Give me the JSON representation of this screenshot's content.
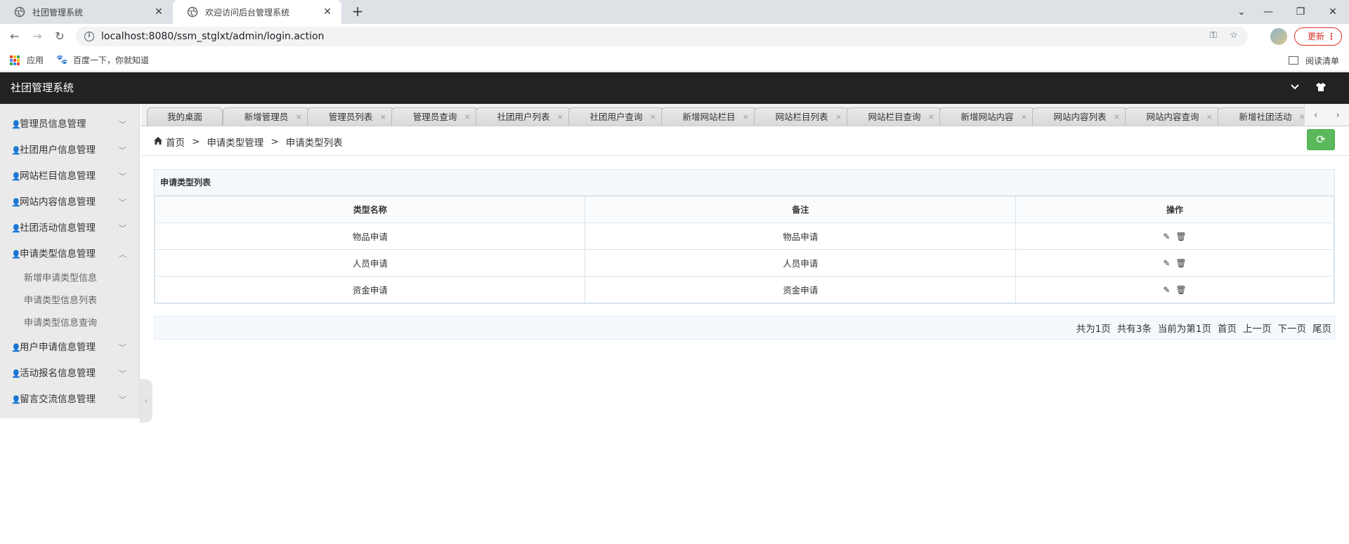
{
  "browser": {
    "tabs": [
      {
        "title": "社团管理系统",
        "close": "✕"
      },
      {
        "title": "欢迎访问后台管理系统",
        "close": "✕"
      }
    ],
    "new_tab": "+",
    "window_controls": {
      "download": "⌄",
      "minimize": "—",
      "restore": "❐",
      "close": "✕"
    },
    "url": "localhost:8080/ssm_stglxt/admin/login.action",
    "update_label": "更新",
    "bookmarks": {
      "apps": "应用",
      "baidu": "百度一下，你就知道",
      "reading_list": "阅读清单"
    }
  },
  "app": {
    "title": "社团管理系统"
  },
  "sidebar": {
    "items": [
      {
        "label": "管理员信息管理",
        "chevron": "﹀"
      },
      {
        "label": "社团用户信息管理",
        "chevron": "﹀"
      },
      {
        "label": "网站栏目信息管理",
        "chevron": "﹀"
      },
      {
        "label": "网站内容信息管理",
        "chevron": "﹀"
      },
      {
        "label": "社团活动信息管理",
        "chevron": "﹀"
      },
      {
        "label": "申请类型信息管理",
        "chevron": "︿"
      },
      {
        "label": "用户申请信息管理",
        "chevron": "﹀"
      },
      {
        "label": "活动报名信息管理",
        "chevron": "﹀"
      },
      {
        "label": "留言交流信息管理",
        "chevron": "﹀"
      }
    ],
    "subitems": [
      "新增申请类型信息",
      "申请类型信息列表",
      "申请类型信息查询"
    ],
    "collapse": "‹"
  },
  "content_tabs": [
    {
      "label": "我的桌面",
      "close": ""
    },
    {
      "label": "新增管理员",
      "close": "×"
    },
    {
      "label": "管理员列表",
      "close": "×"
    },
    {
      "label": "管理员查询",
      "close": "×"
    },
    {
      "label": "社团用户列表",
      "close": "×"
    },
    {
      "label": "社团用户查询",
      "close": "×"
    },
    {
      "label": "新增网站栏目",
      "close": "×"
    },
    {
      "label": "网站栏目列表",
      "close": "×"
    },
    {
      "label": "网站栏目查询",
      "close": "×"
    },
    {
      "label": "新增网站内容",
      "close": "×"
    },
    {
      "label": "网站内容列表",
      "close": "×"
    },
    {
      "label": "网站内容查询",
      "close": "×"
    },
    {
      "label": "新增社团活动",
      "close": "×"
    }
  ],
  "tab_scroll": {
    "prev": "‹",
    "next": "›"
  },
  "breadcrumb": {
    "home": "首页",
    "sep": ">",
    "level1": "申请类型管理",
    "level2": "申请类型列表"
  },
  "panel": {
    "title": "申请类型列表",
    "columns": [
      "类型名称",
      "备注",
      "操作"
    ],
    "rows": [
      {
        "name": "物品申请",
        "remark": "物品申请"
      },
      {
        "name": "人员申请",
        "remark": "人员申请"
      },
      {
        "name": "资金申请",
        "remark": "资金申请"
      }
    ]
  },
  "pager": {
    "total_pages": "共为1页",
    "total_records": "共有3条",
    "current": "当前为第1页",
    "first": "首页",
    "prev": "上一页",
    "next": "下一页",
    "last": "尾页"
  },
  "colors": {
    "header_bg": "#222222",
    "sidebar_bg": "#eaeaea",
    "refresh_green": "#5cb85c",
    "panel_bg": "#f5f9fd"
  }
}
